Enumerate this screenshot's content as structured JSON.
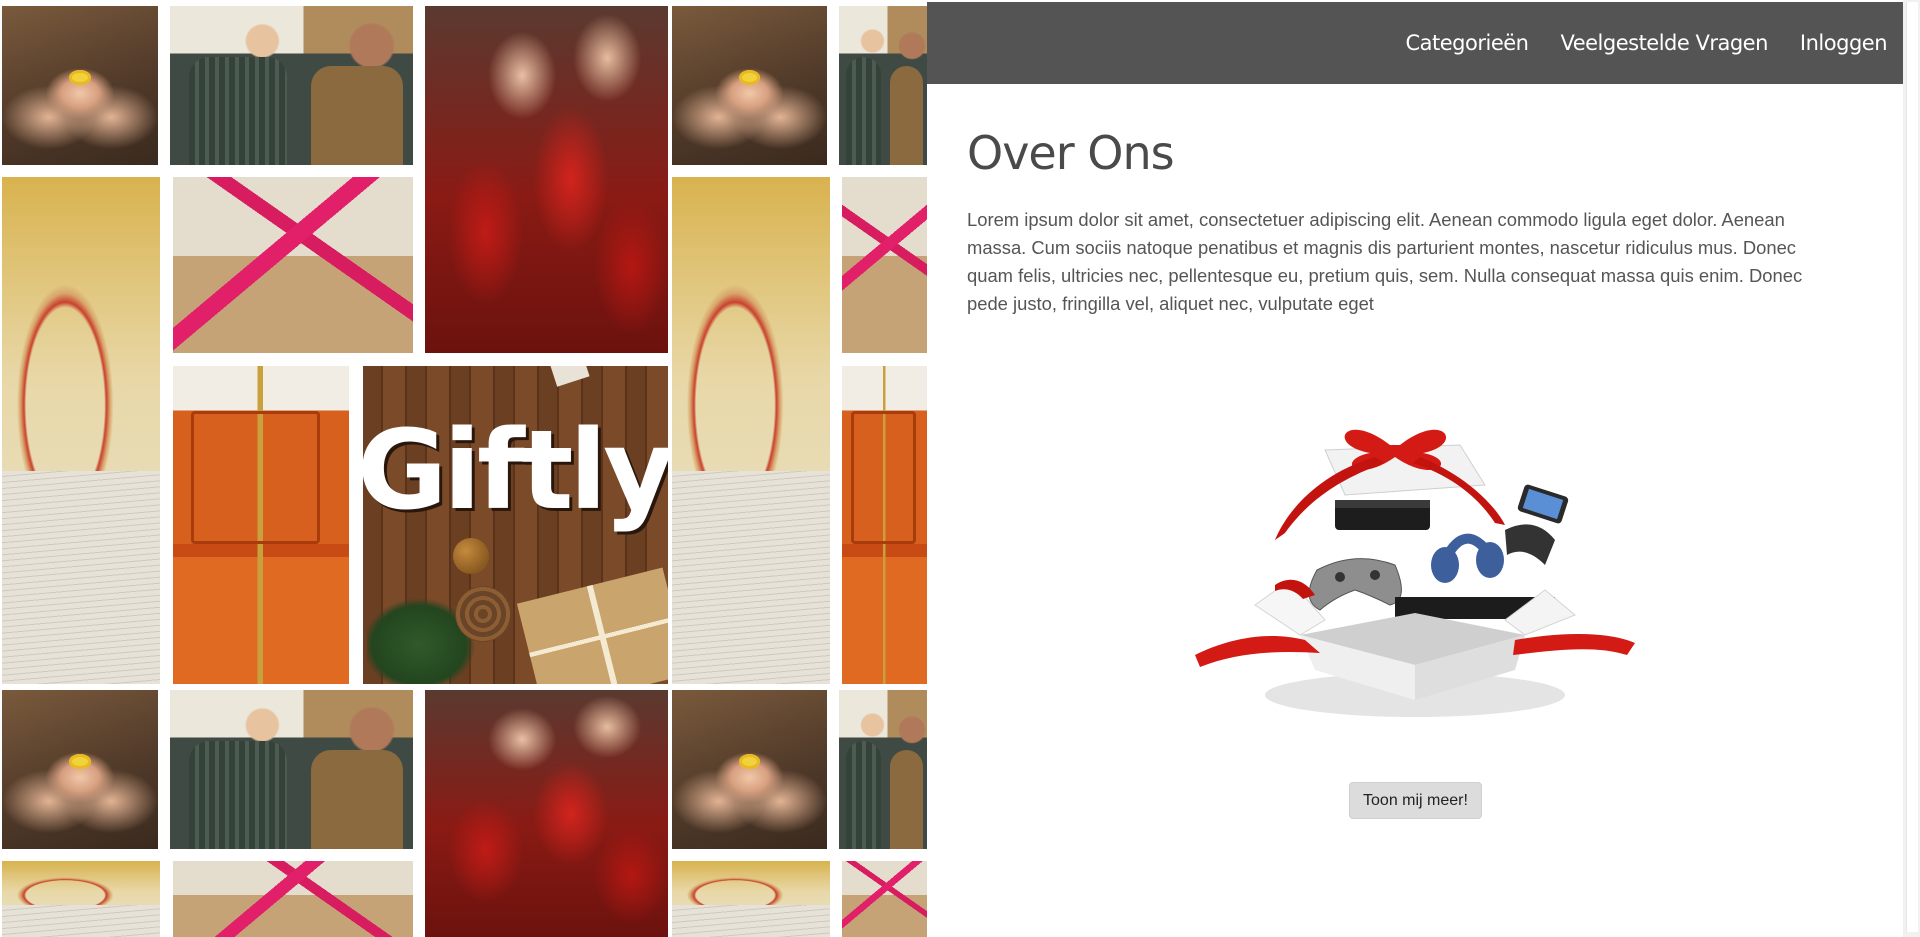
{
  "nav": {
    "links": [
      "Categorieën",
      "Veelgestelde Vragen",
      "Inloggen"
    ]
  },
  "hero": {
    "logo_text": "Giftly"
  },
  "about": {
    "title": "Over Ons",
    "intro": "Lorem ipsum dolor sit amet, consectetuer adipiscing elit. Aenean commodo ligula eget dolor. Aenean massa. Cum sociis natoque penatibus et magnis dis parturient montes, nascetur ridiculus mus. Donec quam felis, ultricies nec, pellentesque eu, pretium quis, sem. Nulla consequat massa quis enim. Donec pede justo, fringilla vel, aliquet nec, vulputate eget",
    "more_button": "Toon mij meer!"
  },
  "colors": {
    "navbar": "#545454",
    "title": "#4a4a4a",
    "text": "#555555",
    "button": "#dcdcdc",
    "ribbon_red": "#d41a14"
  },
  "icons": {
    "gift_illustration": "open-gift-box-with-electronics"
  }
}
